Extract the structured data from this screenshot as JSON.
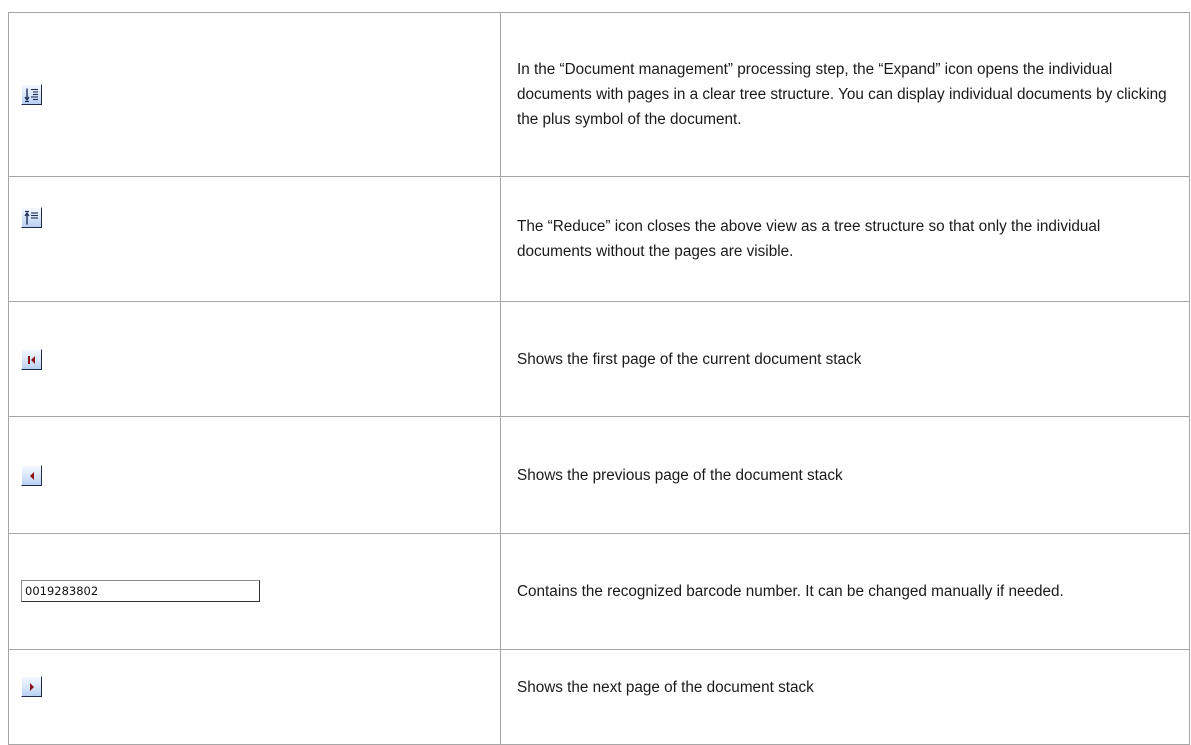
{
  "rows": [
    {
      "icon": "expand-tree-icon",
      "description": "In the “Document management” processing step, the “Expand” icon opens the individual documents with pages in a clear tree structure. You can display individual documents by clicking the plus symbol of the document."
    },
    {
      "icon": "collapse-tree-icon",
      "description": "The “Reduce” icon closes the above view as a tree structure so that only the individual documents without the pages are visible."
    },
    {
      "icon": "first-page-icon",
      "description": "Shows the first page of the current document stack"
    },
    {
      "icon": "previous-page-icon",
      "description": "Shows the previous page of the document stack"
    },
    {
      "icon": "barcode-field",
      "field_value": "0019283802",
      "description": "Contains the recognized barcode number. It can be changed manually if needed."
    },
    {
      "icon": "next-page-icon",
      "description": "Shows the next page of the document stack"
    }
  ],
  "colors": {
    "border": "#a6a6a6",
    "icon_arrow_dark": "#1f2f55",
    "icon_nav_red": "#8b1414"
  }
}
